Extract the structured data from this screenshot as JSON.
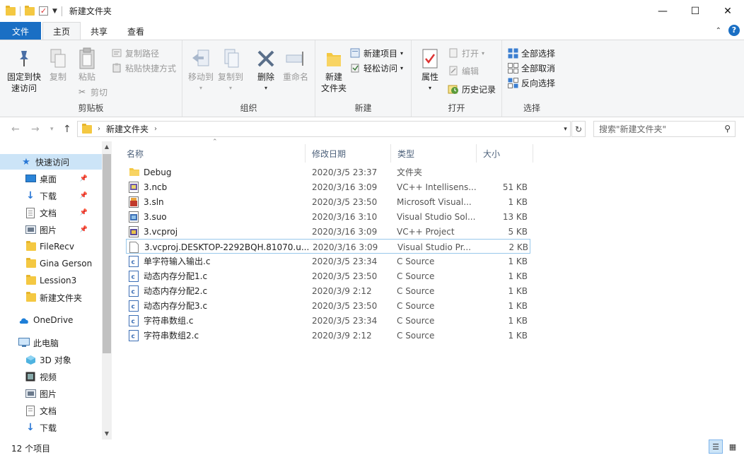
{
  "window": {
    "title": "新建文件夹",
    "minimize_label": "—",
    "maximize_label": "☐",
    "close_label": "✕"
  },
  "tabs": [
    {
      "label": "文件"
    },
    {
      "label": "主页"
    },
    {
      "label": "共享"
    },
    {
      "label": "查看"
    }
  ],
  "ribbon": {
    "clipboard": {
      "label": "剪贴板",
      "pin": "固定到快\n速访问",
      "copy": "复制",
      "paste": "粘贴",
      "copy_path": "复制路径",
      "paste_shortcut": "粘贴快捷方式",
      "cut": "剪切"
    },
    "organize": {
      "label": "组织",
      "move_to": "移动到",
      "copy_to": "复制到",
      "delete": "删除",
      "rename": "重命名"
    },
    "new": {
      "label": "新建",
      "new_folder": "新建\n文件夹",
      "new_item": "新建项目",
      "easy_access": "轻松访问"
    },
    "open": {
      "label": "打开",
      "properties": "属性",
      "open": "打开",
      "edit": "编辑",
      "history": "历史记录"
    },
    "select": {
      "label": "选择",
      "select_all": "全部选择",
      "select_none": "全部取消",
      "invert": "反向选择"
    }
  },
  "address": {
    "path": "新建文件夹",
    "search_placeholder": "搜索\"新建文件夹\""
  },
  "navpane": {
    "quick_access": "快速访问",
    "items": [
      {
        "label": "桌面",
        "pinned": true
      },
      {
        "label": "下载",
        "pinned": true
      },
      {
        "label": "文档",
        "pinned": true
      },
      {
        "label": "图片",
        "pinned": true
      },
      {
        "label": "FileRecv"
      },
      {
        "label": "Gina Gerson"
      },
      {
        "label": "Lession3"
      },
      {
        "label": "新建文件夹"
      }
    ],
    "onedrive": "OneDrive",
    "this_pc": "此电脑",
    "pc_items": [
      {
        "label": "3D 对象"
      },
      {
        "label": "视频"
      },
      {
        "label": "图片"
      },
      {
        "label": "文档"
      },
      {
        "label": "下载"
      }
    ]
  },
  "columns": {
    "name": "名称",
    "date": "修改日期",
    "type": "类型",
    "size": "大小"
  },
  "files": [
    {
      "name": "Debug",
      "date": "2020/3/5 23:37",
      "type": "文件夹",
      "size": "",
      "icon": "folder"
    },
    {
      "name": "3.ncb",
      "date": "2020/3/16 3:09",
      "type": "VC++ Intellisens...",
      "size": "51 KB",
      "icon": "ncb"
    },
    {
      "name": "3.sln",
      "date": "2020/3/5 23:50",
      "type": "Microsoft Visual...",
      "size": "1 KB",
      "icon": "sln"
    },
    {
      "name": "3.suo",
      "date": "2020/3/16 3:10",
      "type": "Visual Studio Sol...",
      "size": "13 KB",
      "icon": "suo"
    },
    {
      "name": "3.vcproj",
      "date": "2020/3/16 3:09",
      "type": "VC++ Project",
      "size": "5 KB",
      "icon": "vcproj"
    },
    {
      "name": "3.vcproj.DESKTOP-2292BQH.81070.u...",
      "date": "2020/3/16 3:09",
      "type": "Visual Studio Pr...",
      "size": "2 KB",
      "icon": "blank"
    },
    {
      "name": "单字符输入输出.c",
      "date": "2020/3/5 23:34",
      "type": "C Source",
      "size": "1 KB",
      "icon": "c"
    },
    {
      "name": "动态内存分配1.c",
      "date": "2020/3/5 23:50",
      "type": "C Source",
      "size": "1 KB",
      "icon": "c"
    },
    {
      "name": "动态内存分配2.c",
      "date": "2020/3/9 2:12",
      "type": "C Source",
      "size": "1 KB",
      "icon": "c"
    },
    {
      "name": "动态内存分配3.c",
      "date": "2020/3/5 23:50",
      "type": "C Source",
      "size": "1 KB",
      "icon": "c"
    },
    {
      "name": "字符串数组.c",
      "date": "2020/3/5 23:34",
      "type": "C Source",
      "size": "1 KB",
      "icon": "c"
    },
    {
      "name": "字符串数组2.c",
      "date": "2020/3/9 2:12",
      "type": "C Source",
      "size": "1 KB",
      "icon": "c"
    }
  ],
  "status": {
    "count": "12 个项目"
  }
}
